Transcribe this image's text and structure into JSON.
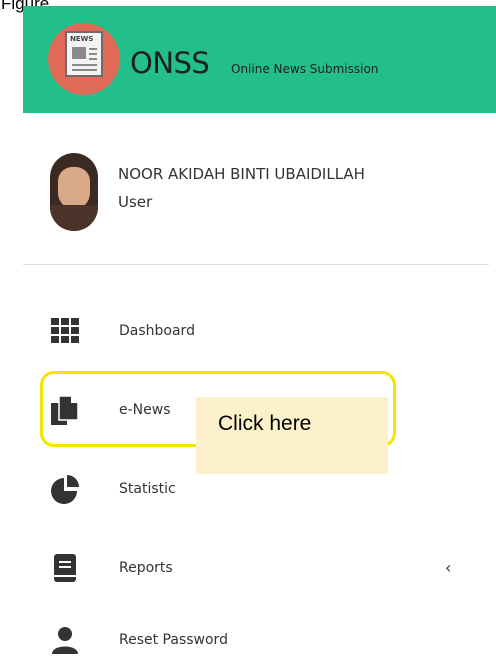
{
  "caption": "Figure",
  "header": {
    "logo_tag": "NEWS",
    "brand": "ONSS",
    "tagline": "Online News Submission",
    "color": "#23bf8a"
  },
  "user": {
    "name": "NOOR AKIDAH BINTI UBAIDILLAH",
    "role": "User"
  },
  "menu": {
    "items": [
      {
        "label": "Dashboard",
        "icon": "grid-icon"
      },
      {
        "label": "e-News",
        "icon": "documents-icon"
      },
      {
        "label": "Statistic",
        "icon": "pie-chart-icon"
      },
      {
        "label": "Reports",
        "icon": "book-icon",
        "chevron": "‹"
      },
      {
        "label": "Reset Password",
        "icon": "user-icon"
      }
    ]
  },
  "annotation": {
    "callout_text": "Click here",
    "highlight_color": "#f2e500",
    "callout_bg": "#fdf1cc"
  }
}
